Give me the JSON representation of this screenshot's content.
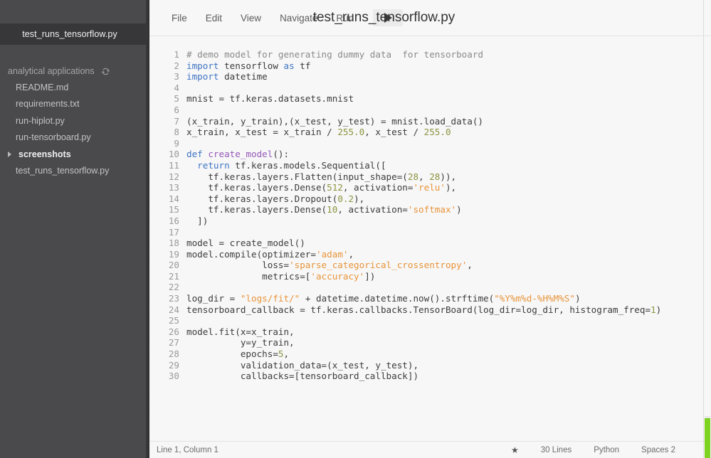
{
  "sidebar": {
    "active_tab": {
      "label": "test_runs_tensorflow.py"
    },
    "project": {
      "label": "analytical applications",
      "refresh_icon": "refresh-icon"
    },
    "items": [
      {
        "label": "README.md",
        "type": "file"
      },
      {
        "label": "requirements.txt",
        "type": "file"
      },
      {
        "label": "run-hiplot.py",
        "type": "file"
      },
      {
        "label": "run-tensorboard.py",
        "type": "file"
      },
      {
        "label": "screenshots",
        "type": "folder",
        "expanded": false,
        "caret_icon": "chevron-right-icon"
      },
      {
        "label": "test_runs_tensorflow.py",
        "type": "file"
      }
    ]
  },
  "header": {
    "menu": [
      {
        "label": "File"
      },
      {
        "label": "Edit"
      },
      {
        "label": "View"
      },
      {
        "label": "Navigate"
      },
      {
        "label": "Run"
      }
    ],
    "run_button": {
      "icon": "play-icon",
      "label": ""
    },
    "title": "test_runs_tensorflow.py"
  },
  "editor": {
    "language": "Python",
    "lines": [
      {
        "n": "1",
        "tokens": [
          {
            "t": "# demo model for generating dummy data  for tensorboard",
            "c": "t-com"
          }
        ]
      },
      {
        "n": "2",
        "tokens": [
          {
            "t": "import",
            "c": "t-kw"
          },
          {
            "t": " tensorflow ",
            "c": ""
          },
          {
            "t": "as",
            "c": "t-kw"
          },
          {
            "t": " tf",
            "c": ""
          }
        ]
      },
      {
        "n": "3",
        "tokens": [
          {
            "t": "import",
            "c": "t-kw"
          },
          {
            "t": " datetime",
            "c": ""
          }
        ]
      },
      {
        "n": "4",
        "tokens": [
          {
            "t": "",
            "c": ""
          }
        ]
      },
      {
        "n": "5",
        "tokens": [
          {
            "t": "mnist = tf.keras.datasets.mnist",
            "c": ""
          }
        ]
      },
      {
        "n": "6",
        "tokens": [
          {
            "t": "",
            "c": ""
          }
        ]
      },
      {
        "n": "7",
        "tokens": [
          {
            "t": "(x_train, y_train),(x_test, y_test) = mnist.load_data()",
            "c": ""
          }
        ]
      },
      {
        "n": "8",
        "tokens": [
          {
            "t": "x_train, x_test = x_train / ",
            "c": ""
          },
          {
            "t": "255.0",
            "c": "t-num"
          },
          {
            "t": ", x_test / ",
            "c": ""
          },
          {
            "t": "255.0",
            "c": "t-num"
          }
        ]
      },
      {
        "n": "9",
        "tokens": [
          {
            "t": "",
            "c": ""
          }
        ]
      },
      {
        "n": "10",
        "tokens": [
          {
            "t": "def",
            "c": "t-kw"
          },
          {
            "t": " ",
            "c": ""
          },
          {
            "t": "create_model",
            "c": "t-fn"
          },
          {
            "t": "():",
            "c": ""
          }
        ]
      },
      {
        "n": "11",
        "tokens": [
          {
            "t": "  ",
            "c": ""
          },
          {
            "t": "return",
            "c": "t-kw"
          },
          {
            "t": " tf.keras.models.Sequential([",
            "c": ""
          }
        ]
      },
      {
        "n": "12",
        "tokens": [
          {
            "t": "    tf.keras.layers.Flatten(input_shape=(",
            "c": ""
          },
          {
            "t": "28",
            "c": "t-num"
          },
          {
            "t": ", ",
            "c": ""
          },
          {
            "t": "28",
            "c": "t-num"
          },
          {
            "t": ")),",
            "c": ""
          }
        ]
      },
      {
        "n": "13",
        "tokens": [
          {
            "t": "    tf.keras.layers.Dense(",
            "c": ""
          },
          {
            "t": "512",
            "c": "t-num"
          },
          {
            "t": ", activation=",
            "c": ""
          },
          {
            "t": "'relu'",
            "c": "t-str"
          },
          {
            "t": "),",
            "c": ""
          }
        ]
      },
      {
        "n": "14",
        "tokens": [
          {
            "t": "    tf.keras.layers.Dropout(",
            "c": ""
          },
          {
            "t": "0.2",
            "c": "t-num"
          },
          {
            "t": "),",
            "c": ""
          }
        ]
      },
      {
        "n": "15",
        "tokens": [
          {
            "t": "    tf.keras.layers.Dense(",
            "c": ""
          },
          {
            "t": "10",
            "c": "t-num"
          },
          {
            "t": ", activation=",
            "c": ""
          },
          {
            "t": "'softmax'",
            "c": "t-str"
          },
          {
            "t": ")",
            "c": ""
          }
        ]
      },
      {
        "n": "16",
        "tokens": [
          {
            "t": "  ])",
            "c": ""
          }
        ]
      },
      {
        "n": "17",
        "tokens": [
          {
            "t": "",
            "c": ""
          }
        ]
      },
      {
        "n": "18",
        "tokens": [
          {
            "t": "model = create_model()",
            "c": ""
          }
        ]
      },
      {
        "n": "19",
        "tokens": [
          {
            "t": "model.compile(optimizer=",
            "c": ""
          },
          {
            "t": "'adam'",
            "c": "t-str"
          },
          {
            "t": ",",
            "c": ""
          }
        ]
      },
      {
        "n": "20",
        "tokens": [
          {
            "t": "              loss=",
            "c": ""
          },
          {
            "t": "'sparse_categorical_crossentropy'",
            "c": "t-str"
          },
          {
            "t": ",",
            "c": ""
          }
        ]
      },
      {
        "n": "21",
        "tokens": [
          {
            "t": "              metrics=[",
            "c": ""
          },
          {
            "t": "'accuracy'",
            "c": "t-str"
          },
          {
            "t": "])",
            "c": ""
          }
        ]
      },
      {
        "n": "22",
        "tokens": [
          {
            "t": "",
            "c": ""
          }
        ]
      },
      {
        "n": "23",
        "tokens": [
          {
            "t": "log_dir = ",
            "c": ""
          },
          {
            "t": "\"logs/fit/\"",
            "c": "t-str"
          },
          {
            "t": " + datetime.datetime.now().strftime(",
            "c": ""
          },
          {
            "t": "\"%Y%m%d-%H%M%S\"",
            "c": "t-str"
          },
          {
            "t": ")",
            "c": ""
          }
        ]
      },
      {
        "n": "24",
        "tokens": [
          {
            "t": "tensorboard_callback = tf.keras.callbacks.TensorBoard(log_dir=log_dir, histogram_freq=",
            "c": ""
          },
          {
            "t": "1",
            "c": "t-num"
          },
          {
            "t": ")",
            "c": ""
          }
        ]
      },
      {
        "n": "25",
        "tokens": [
          {
            "t": "",
            "c": ""
          }
        ]
      },
      {
        "n": "26",
        "tokens": [
          {
            "t": "model.fit(x=x_train,",
            "c": ""
          }
        ]
      },
      {
        "n": "27",
        "tokens": [
          {
            "t": "          y=y_train,",
            "c": ""
          }
        ]
      },
      {
        "n": "28",
        "tokens": [
          {
            "t": "          epochs=",
            "c": ""
          },
          {
            "t": "5",
            "c": "t-num"
          },
          {
            "t": ",",
            "c": ""
          }
        ]
      },
      {
        "n": "29",
        "tokens": [
          {
            "t": "          validation_data=(x_test, y_test),",
            "c": ""
          }
        ]
      },
      {
        "n": "30",
        "tokens": [
          {
            "t": "          callbacks=[tensorboard_callback])",
            "c": ""
          }
        ]
      }
    ]
  },
  "statusbar": {
    "cursor": "Line 1, Column 1",
    "star_icon": "star-icon",
    "line_count": "30 Lines",
    "language": "Python",
    "indentation": "Spaces 2"
  },
  "colors": {
    "sidebar_bg": "#4a4a4d",
    "sidebar_tab_bg": "#37373a",
    "editor_bg": "#f7f7f7",
    "keyword": "#3f74c4",
    "function": "#9659b8",
    "string": "#e8943a",
    "number": "#8c9440",
    "comment": "#8a8a8a",
    "indicator_green": "#7ed321"
  }
}
